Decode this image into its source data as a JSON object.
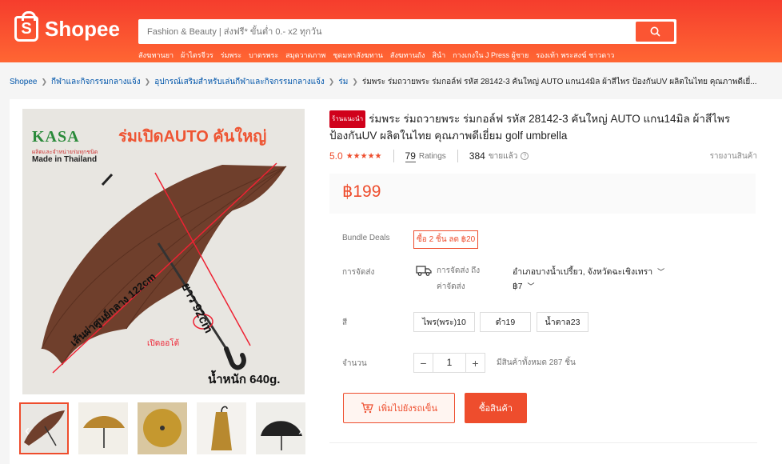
{
  "brand": {
    "name": "Shopee"
  },
  "search": {
    "placeholder": "Fashion & Beauty | ส่งฟรี* ขั้นต่ำ 0.- x2 ทุกวัน"
  },
  "suggestions": [
    "สังฆทานยา",
    "ผ้าไตรจีวร",
    "ร่มพระ",
    "บาตรพระ",
    "สมุดวาดภาพ",
    "ชุดมหาสังฆทาน",
    "สังฆทานถัง",
    "สินำ",
    "กางเกงใน J Press ผู้ชาย",
    "รองเท้า พระสงฆ์ ชาวดาว"
  ],
  "breadcrumb": [
    "Shopee",
    "กีฬาและกิจกรรมกลางแจ้ง",
    "อุปกรณ์เสริมสำหรับเล่นกีฬาและกิจกรรมกลางแจ้ง",
    "ร่ม",
    "ร่มพระ ร่มถวายพระ ร่มกอล์ฟ รหัส 28142-3 คันใหญ่ AUTO แกน14มิล ผ้าสีไพร ป้องกันUV ผลิตในไทย คุณภาพดีเยี่..."
  ],
  "product": {
    "badge": "ร้านแนะนำ",
    "title": "ร่มพระ ร่มถวายพระ ร่มกอล์ฟ รหัส 28142-3 คันใหญ่ AUTO แกน14มิล ผ้าสีไพร ป้องกันUV ผลิตในไทย คุณภาพดีเยี่ยม golf umbrella",
    "rating": "5.0",
    "ratings_count": "79",
    "ratings_label": "Ratings",
    "sold_count": "384",
    "sold_label": "ขายแล้ว",
    "report": "รายงานสินค้า",
    "price": "฿199"
  },
  "image": {
    "brand": "KASA",
    "brand_sub": "ผลิตและจำหน่ายร่มทุกชนิด",
    "made_in": "Made in Thailand",
    "headline": "ร่มเปิดAUTO คันใหญ่",
    "dim_diameter": "เส้นผ่าศูนย์กลาง 122cm",
    "dim_length": "ยาว 92cm",
    "auto_label": "เปิดออโต้",
    "weight": "น้ำหนัก 640g."
  },
  "bundle": {
    "label": "Bundle Deals",
    "deal": "ซื้อ 2 ชิ้น ลด ฿20"
  },
  "shipping": {
    "label": "การจัดส่ง",
    "to_label": "การจัดส่ง ถึง",
    "to_value": "อำเภอบางน้ำเปรี้ยว, จังหวัดฉะเชิงเทรา",
    "cost_label": "ค่าจัดส่ง",
    "cost_value": "฿7"
  },
  "color": {
    "label": "สี",
    "options": [
      "ไพร(พระ)10",
      "ดำ19",
      "น้ำตาล23"
    ]
  },
  "quantity": {
    "label": "จำนวน",
    "value": "1",
    "stock": "มีสินค้าทั้งหมด 287 ชิ้น"
  },
  "actions": {
    "add_to_cart": "เพิ่มไปยังรถเข็น",
    "buy_now": "ซื้อสินค้า"
  },
  "colors": {
    "primary": "#ee4d2d",
    "umbrella": "#6f3f2c"
  }
}
